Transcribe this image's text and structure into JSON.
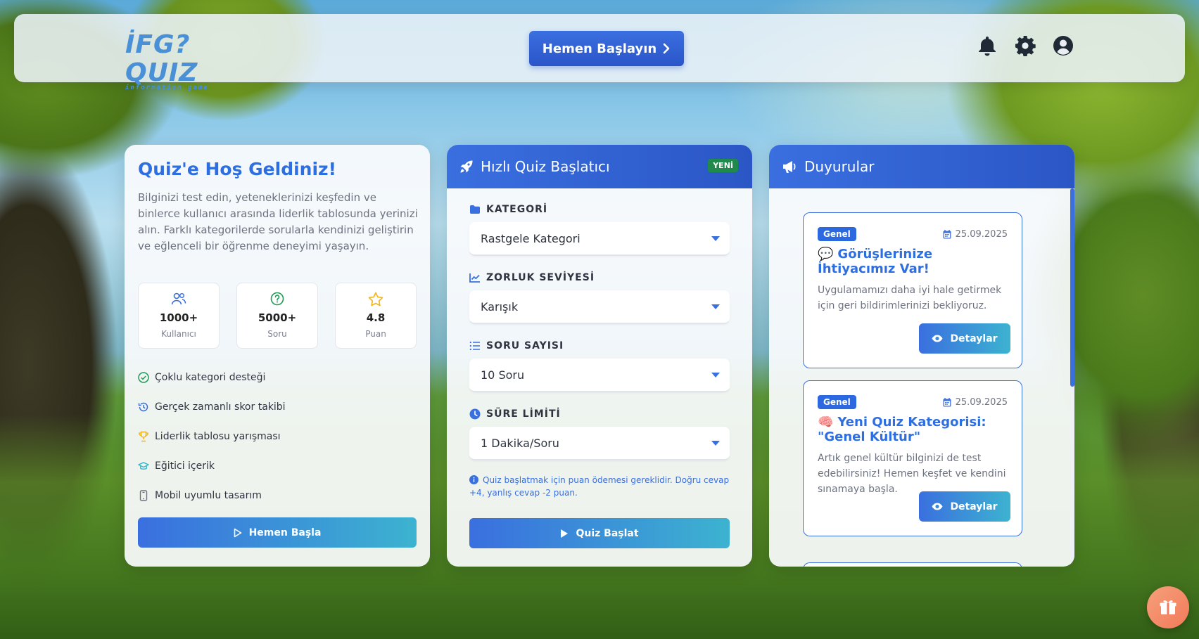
{
  "navbar": {
    "logo_main": "İFG?QUIZ",
    "logo_sub": "information game",
    "cta_label": "Hemen Başlayın",
    "icons": [
      "bell-icon",
      "gear-icon",
      "user-circle-icon"
    ]
  },
  "welcome": {
    "title": "Quiz'e Hoş Geldiniz!",
    "description": "Bilginizi test edin, yeteneklerinizi keşfedin ve binlerce kullanıcı arasında liderlik tablosunda yerinizi alın. Farklı kategorilerde sorularla kendinizi geliştirin ve eğlenceli bir öğrenme deneyimi yaşayın.",
    "stats": [
      {
        "value": "1000+",
        "label": "Kullanıcı",
        "icon": "users-icon"
      },
      {
        "value": "5000+",
        "label": "Soru",
        "icon": "question-circle-icon"
      },
      {
        "value": "4.8",
        "label": "Puan",
        "icon": "star-icon"
      }
    ],
    "features": [
      {
        "label": "Çoklu kategori desteği",
        "icon": "check-circle-icon"
      },
      {
        "label": "Gerçek zamanlı skor takibi",
        "icon": "history-icon"
      },
      {
        "label": "Liderlik tablosu yarışması",
        "icon": "trophy-icon"
      },
      {
        "label": "Eğitici içerik",
        "icon": "graduation-cap-icon"
      },
      {
        "label": "Mobil uyumlu tasarım",
        "icon": "mobile-icon"
      }
    ],
    "start_label": "Hemen Başla"
  },
  "quick_quiz": {
    "title": "Hızlı Quiz Başlatıcı",
    "badge": "YENİ",
    "fields": [
      {
        "label": "KATEGORİ",
        "value": "Rastgele Kategori",
        "icon": "folder-icon"
      },
      {
        "label": "ZORLUK SEVİYESİ",
        "value": "Karışık",
        "icon": "chart-line-icon"
      },
      {
        "label": "SORU SAYISI",
        "value": "10 Soru",
        "icon": "list-icon"
      },
      {
        "label": "SÜRE LİMİTİ",
        "value": "1 Dakika/Soru",
        "icon": "clock-icon"
      }
    ],
    "note": "Quiz başlatmak için puan ödemesi gereklidir. Doğru cevap +4, yanlış cevap -2 puan.",
    "start_label": "Quiz Başlat"
  },
  "announcements": {
    "title": "Duyurular",
    "items": [
      {
        "tag": "Genel",
        "date": "25.09.2025",
        "emoji": "💬",
        "title": "Görüşlerinize İhtiyacımız Var!",
        "text": "Uygulamamızı daha iyi hale getirmek için geri bildirimlerinizi bekliyoruz.",
        "button": "Detaylar"
      },
      {
        "tag": "Genel",
        "date": "25.09.2025",
        "emoji": "🧠",
        "title": "Yeni Quiz Kategorisi: \"Genel Kültür\"",
        "text": "Artık genel kültür bilginizi de test edebilirsiniz! Hemen keşfet ve kendini sınamaya başla.",
        "button": "Detaylar"
      }
    ]
  },
  "colors": {
    "primary": "#3a6fdf",
    "accent": "#3cb3d0",
    "success": "#1f8a4c",
    "gift": "#f27a5a"
  }
}
